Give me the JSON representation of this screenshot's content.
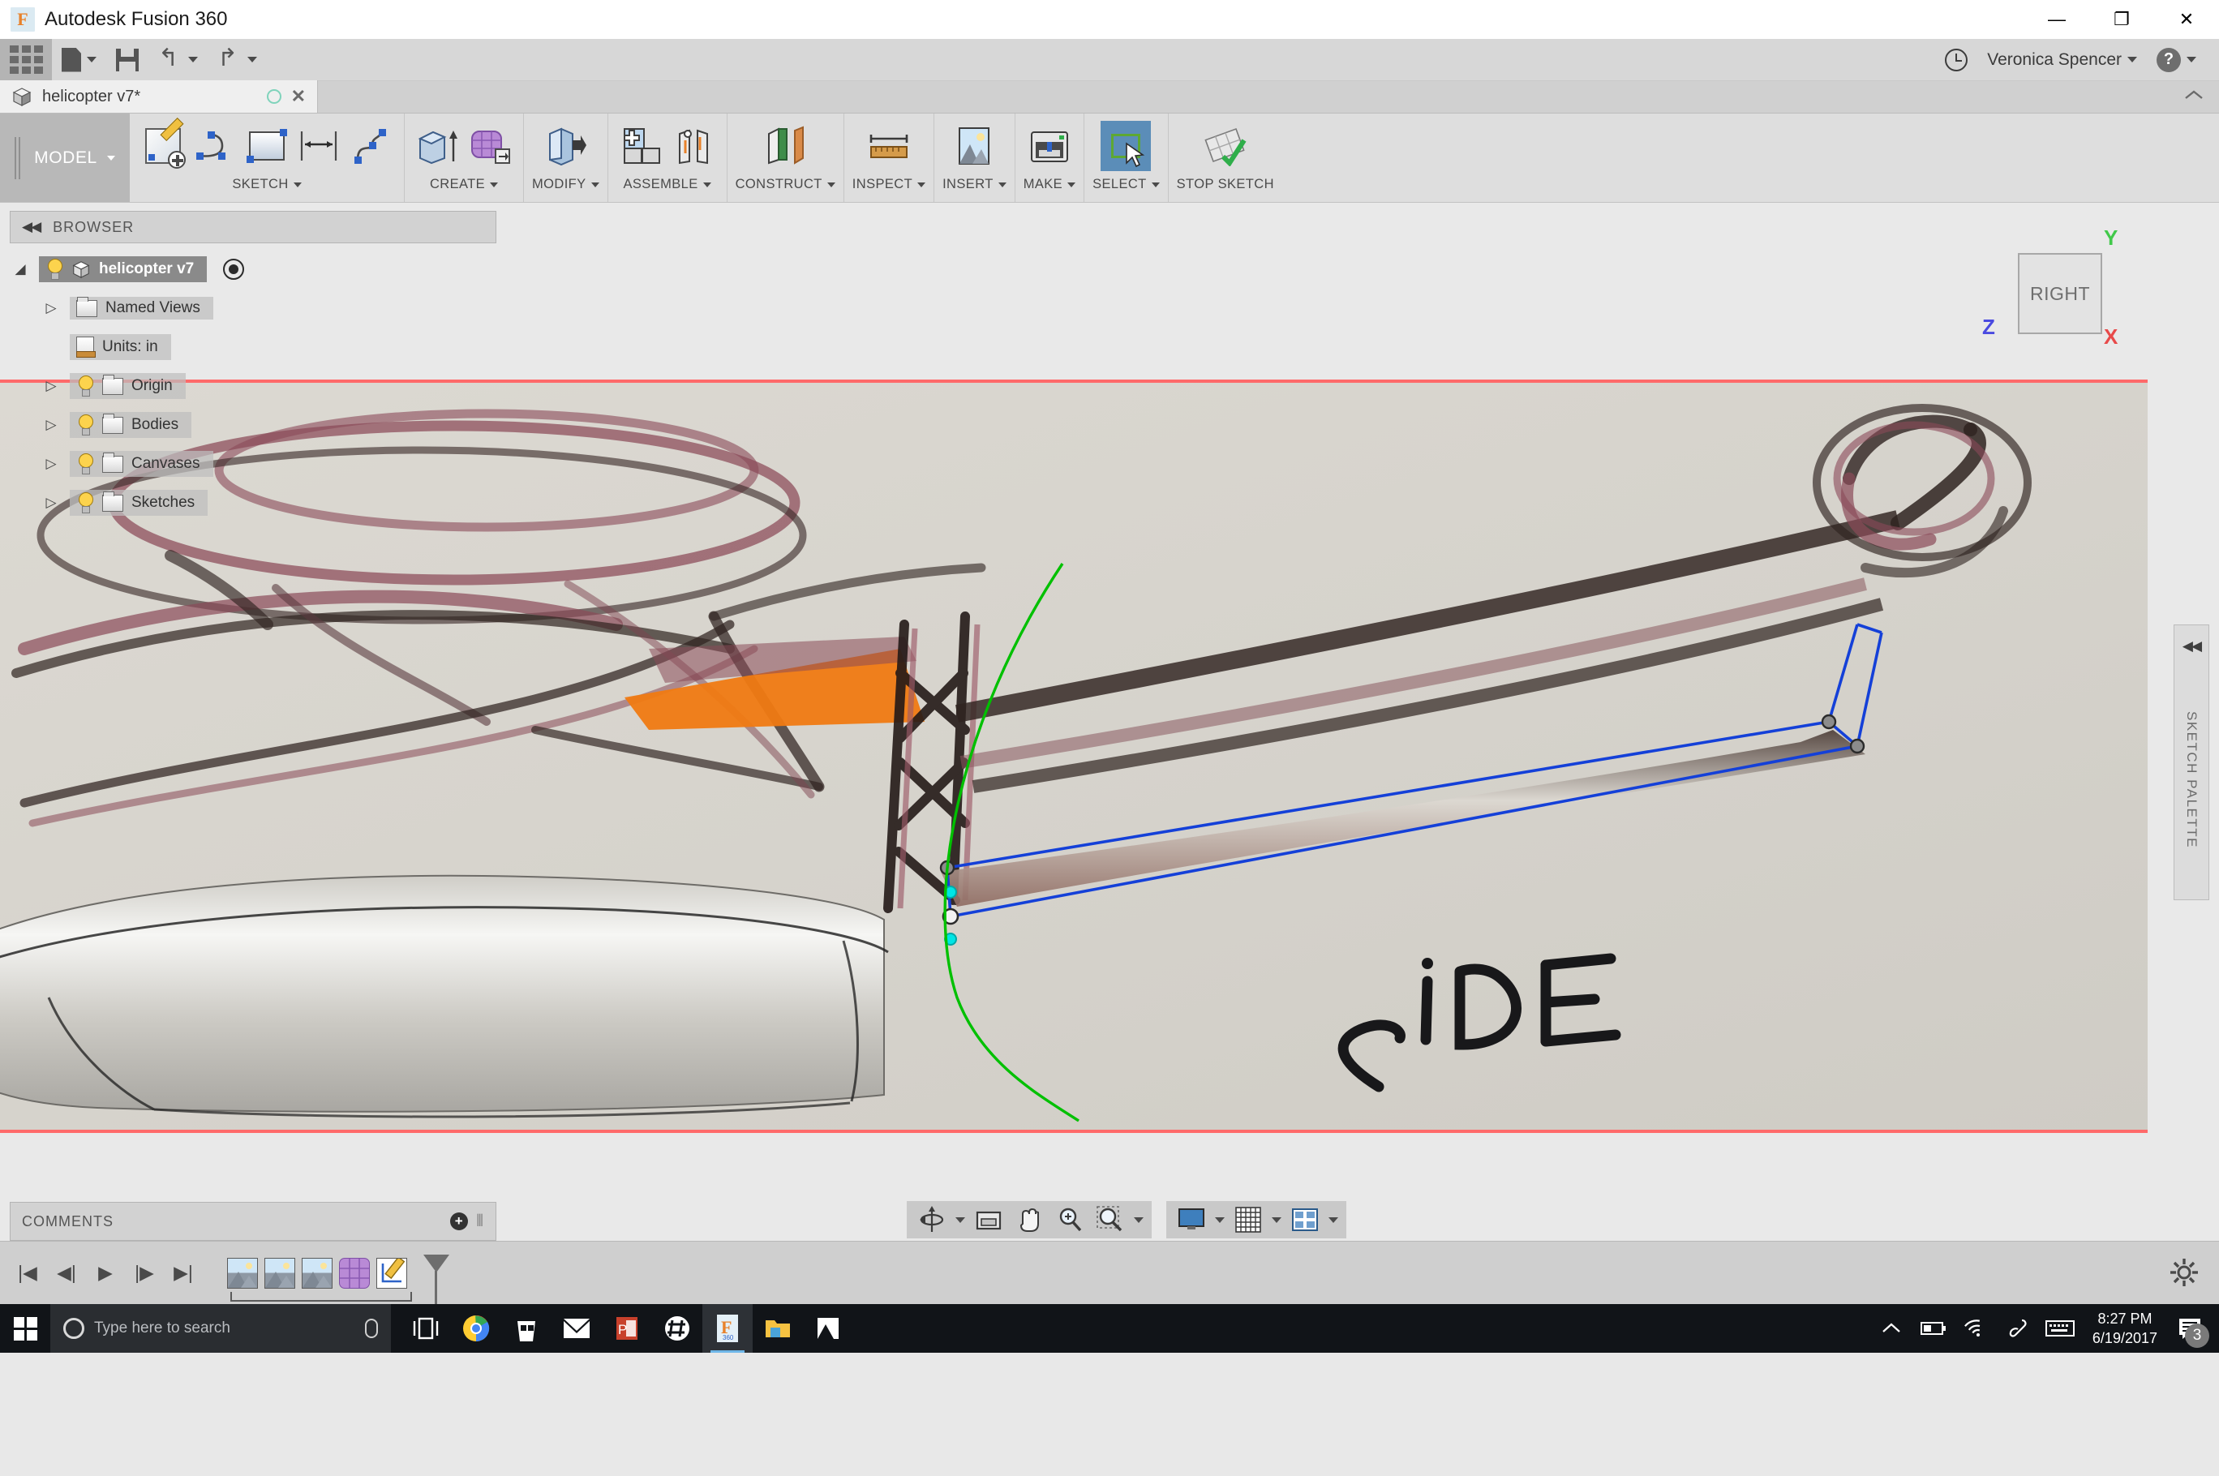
{
  "window": {
    "app_title": "Autodesk Fusion 360",
    "app_icon": "fusion-logo-icon",
    "minimize": "—",
    "maximize": "❐",
    "close": "✕"
  },
  "quick_access": {
    "grid_icon": "app-grid-icon",
    "new_icon": "new-document-icon",
    "save_icon": "save-icon",
    "undo_icon": "undo-icon",
    "redo_icon": "redo-icon",
    "history_icon": "job-status-clock-icon",
    "user_name": "Veronica Spencer",
    "help_label": "?",
    "help_icon": "help-icon"
  },
  "tab": {
    "label": "helicopter v7*",
    "doc_icon": "cube-icon",
    "status_icon": "sync-circle-icon",
    "close_icon": "close-icon"
  },
  "ribbon": {
    "workspace": "MODEL",
    "groups": [
      {
        "label": "SKETCH",
        "has_caret": true,
        "buttons": [
          "create-sketch-icon",
          "arc-icon",
          "rectangle-icon",
          "dimension-icon",
          "spline-icon"
        ]
      },
      {
        "label": "CREATE",
        "has_caret": true,
        "buttons": [
          "extrude-icon",
          "create-form-icon"
        ]
      },
      {
        "label": "MODIFY",
        "has_caret": true,
        "buttons": [
          "press-pull-icon"
        ]
      },
      {
        "label": "ASSEMBLE",
        "has_caret": true,
        "buttons": [
          "new-component-icon",
          "joint-icon"
        ]
      },
      {
        "label": "CONSTRUCT",
        "has_caret": true,
        "buttons": [
          "offset-plane-icon"
        ]
      },
      {
        "label": "INSPECT",
        "has_caret": true,
        "buttons": [
          "measure-icon"
        ]
      },
      {
        "label": "INSERT",
        "has_caret": true,
        "buttons": [
          "insert-canvas-icon"
        ]
      },
      {
        "label": "MAKE",
        "has_caret": true,
        "buttons": [
          "3d-print-icon"
        ]
      },
      {
        "label": "SELECT",
        "has_caret": true,
        "active": true,
        "buttons": [
          "select-window-icon"
        ]
      },
      {
        "label": "STOP SKETCH",
        "has_caret": false,
        "buttons": [
          "stop-sketch-icon"
        ]
      }
    ],
    "collapse_icon": "collapse-ribbon-icon"
  },
  "browser": {
    "title": "BROWSER",
    "collapse_icon": "collapse-panel-icon",
    "root": {
      "label": "helicopter v7",
      "light": true,
      "selected": true,
      "radio": "display-state-icon"
    },
    "items": [
      {
        "label": "Named Views",
        "twist": true,
        "light": false,
        "icon": "folder-icon"
      },
      {
        "label": "Units: in",
        "twist": false,
        "light": false,
        "icon": "document-icon"
      },
      {
        "label": "Origin",
        "twist": true,
        "light": true,
        "icon": "folder-icon"
      },
      {
        "label": "Bodies",
        "twist": true,
        "light": true,
        "icon": "folder-icon"
      },
      {
        "label": "Canvases",
        "twist": true,
        "light": true,
        "icon": "folder-icon"
      },
      {
        "label": "Sketches",
        "twist": true,
        "light": true,
        "icon": "folder-icon"
      }
    ]
  },
  "viewcube": {
    "face_label": "RIGHT",
    "axis_y": "Y",
    "axis_z": "Z",
    "axis_x": "X"
  },
  "sketch_palette": {
    "title": "SKETCH PALETTE",
    "collapse_icon": "collapse-panel-icon"
  },
  "comments": {
    "title": "COMMENTS",
    "add_icon": "add-comment-icon"
  },
  "navbar": {
    "buttons": [
      {
        "name": "orbit-icon",
        "caret": true
      },
      {
        "name": "look-at-icon",
        "caret": false
      },
      {
        "name": "pan-icon",
        "caret": false
      },
      {
        "name": "zoom-icon",
        "caret": false
      },
      {
        "name": "fit-icon",
        "caret": true
      }
    ],
    "display_buttons": [
      {
        "name": "display-settings-icon",
        "caret": true
      },
      {
        "name": "grid-snaps-icon",
        "caret": true
      },
      {
        "name": "viewports-icon",
        "caret": true
      }
    ]
  },
  "timeline": {
    "playback": [
      "skip-start-icon",
      "step-back-icon",
      "play-icon",
      "step-forward-icon",
      "skip-end-icon"
    ],
    "features": [
      {
        "name": "canvas-feature-icon",
        "type": "canvas"
      },
      {
        "name": "canvas-feature-icon",
        "type": "canvas"
      },
      {
        "name": "canvas-feature-icon",
        "type": "canvas"
      },
      {
        "name": "form-feature-icon",
        "type": "form"
      },
      {
        "name": "sketch-feature-icon",
        "type": "sketch"
      }
    ],
    "settings_icon": "timeline-settings-icon"
  },
  "canvas": {
    "reference_text": "SiDE",
    "sketch_line_color": "#1440d8",
    "construction_color": "#00c000",
    "point_color": "#00e5e5",
    "plane_edge_color": "#ff6a6a"
  },
  "taskbar": {
    "start_icon": "windows-start-icon",
    "search_placeholder": "Type here to search",
    "cortana_icon": "cortana-icon",
    "mic_icon": "microphone-icon",
    "apps": [
      {
        "name": "task-view-icon"
      },
      {
        "name": "chrome-icon"
      },
      {
        "name": "microsoft-store-icon"
      },
      {
        "name": "mail-icon"
      },
      {
        "name": "powerpoint-icon"
      },
      {
        "name": "slack-icon"
      },
      {
        "name": "fusion360-icon",
        "active": true
      },
      {
        "name": "file-explorer-icon"
      },
      {
        "name": "photos-icon"
      }
    ],
    "tray": [
      "show-hidden-icons-icon",
      "battery-icon",
      "wifi-icon",
      "pen-icon",
      "keyboard-icon"
    ],
    "time": "8:27 PM",
    "date": "6/19/2017",
    "notification_icon": "action-center-icon",
    "notification_count": "3"
  }
}
